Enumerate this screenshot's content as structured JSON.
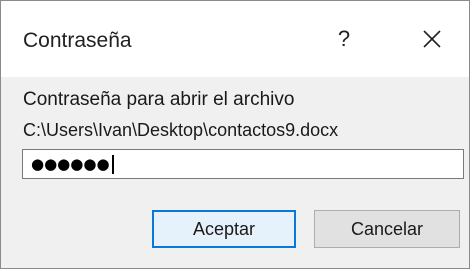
{
  "dialog": {
    "title": "Contraseña",
    "help_label": "?",
    "close_icon": "close-icon",
    "prompt": "Contraseña para abrir el archivo",
    "file_path": "C:\\Users\\Ivan\\Desktop\\contactos9.docx",
    "password_masked": "●●●●●●",
    "ok_label": "Aceptar",
    "cancel_label": "Cancelar"
  },
  "colors": {
    "dialog_background": "#f0f0f0",
    "titlebar_background": "#ffffff",
    "default_button_border": "#0a78d7",
    "default_button_fill": "#e5f1fb",
    "button_fill": "#e1e1e1"
  }
}
